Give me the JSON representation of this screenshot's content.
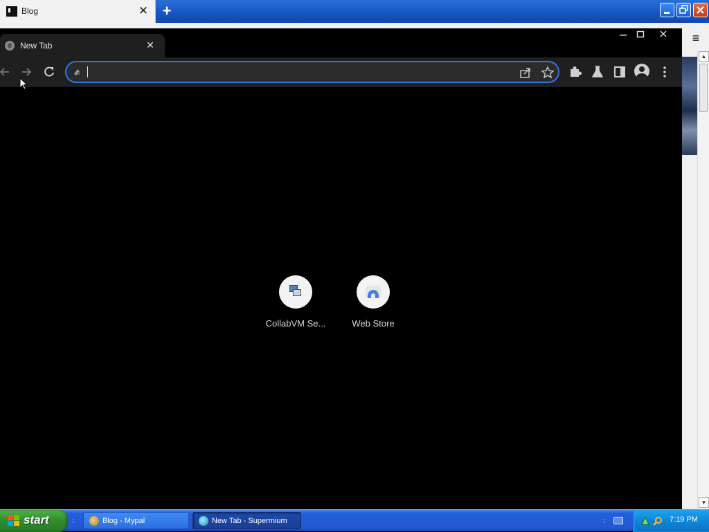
{
  "background_browser": {
    "tab_title": "Blog",
    "close_glyph": "✕",
    "new_tab_glyph": "+",
    "menu_glyph": "≡",
    "window_controls": [
      "minimize",
      "restore",
      "close"
    ]
  },
  "browser": {
    "name": "Supermium",
    "tab": {
      "title": "New Tab",
      "close_glyph": "✕"
    },
    "window_controls": [
      "minimize",
      "maximize",
      "close"
    ],
    "toolbar": {
      "back_icon": "arrow-left-icon",
      "forward_icon": "arrow-right-icon",
      "reload_icon": "reload-icon",
      "omnibox": {
        "value": "",
        "placeholder": ""
      },
      "share_icon": "share-icon",
      "bookmark_icon": "star-icon",
      "extensions_icon": "puzzle-icon",
      "labs_icon": "flask-icon",
      "side_panel_icon": "side-panel-icon",
      "profile_icon": "avatar-icon",
      "menu_icon": "kebab-menu-icon"
    },
    "shortcuts": [
      {
        "label": "CollabVM Se...",
        "icon": "collabvm-icon"
      },
      {
        "label": "Web Store",
        "icon": "web-store-icon"
      }
    ]
  },
  "taskbar": {
    "start_label": "start",
    "tasks": [
      {
        "label": "Blog - Mypal",
        "active": false
      },
      {
        "label": "New Tab - Supermium",
        "active": true
      }
    ],
    "clock": "7:19 PM"
  },
  "colors": {
    "omnibox_focus": "#2f78e6",
    "toolbar_bg": "#1f1f1f",
    "taskbar_blue": "#245ed8",
    "start_green": "#2f8b2d",
    "tray_blue": "#0f86d8"
  }
}
